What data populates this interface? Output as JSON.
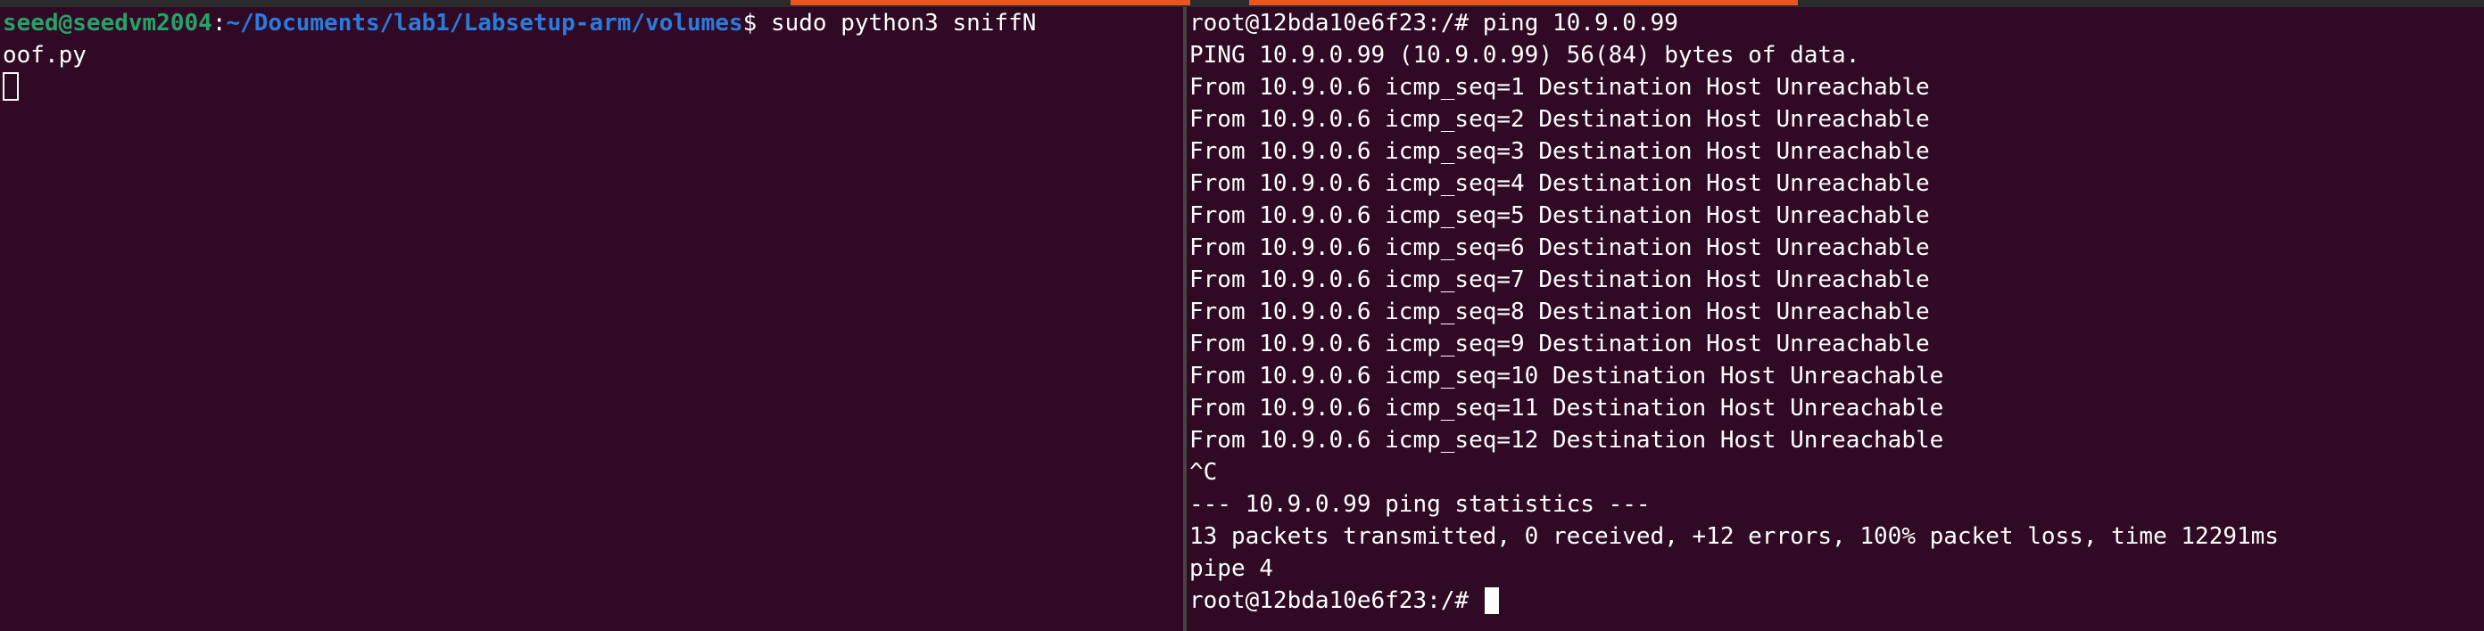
{
  "colors": {
    "background": "#300a24",
    "prompt_user": "#26a269",
    "prompt_path": "#2a7bde",
    "tab_accent": "#e95420"
  },
  "left_terminal": {
    "prompt_user_host": "seed@seedvm2004",
    "prompt_sep": ":",
    "prompt_path": "~/Documents/lab1/Labsetup-arm/volumes",
    "prompt_symbol": "$ ",
    "command_part1": "sudo python3 sniffN",
    "command_wrap": "oof.py"
  },
  "right_terminal": {
    "prompt": "root@12bda10e6f23:/# ",
    "command": "ping 10.9.0.99",
    "lines": [
      "PING 10.9.0.99 (10.9.0.99) 56(84) bytes of data.",
      "From 10.9.0.6 icmp_seq=1 Destination Host Unreachable",
      "From 10.9.0.6 icmp_seq=2 Destination Host Unreachable",
      "From 10.9.0.6 icmp_seq=3 Destination Host Unreachable",
      "From 10.9.0.6 icmp_seq=4 Destination Host Unreachable",
      "From 10.9.0.6 icmp_seq=5 Destination Host Unreachable",
      "From 10.9.0.6 icmp_seq=6 Destination Host Unreachable",
      "From 10.9.0.6 icmp_seq=7 Destination Host Unreachable",
      "From 10.9.0.6 icmp_seq=8 Destination Host Unreachable",
      "From 10.9.0.6 icmp_seq=9 Destination Host Unreachable",
      "From 10.9.0.6 icmp_seq=10 Destination Host Unreachable",
      "From 10.9.0.6 icmp_seq=11 Destination Host Unreachable",
      "From 10.9.0.6 icmp_seq=12 Destination Host Unreachable",
      "^C",
      "--- 10.9.0.99 ping statistics ---",
      "13 packets transmitted, 0 received, +12 errors, 100% packet loss, time 12291ms",
      "pipe 4"
    ],
    "final_prompt": "root@12bda10e6f23:/# "
  }
}
